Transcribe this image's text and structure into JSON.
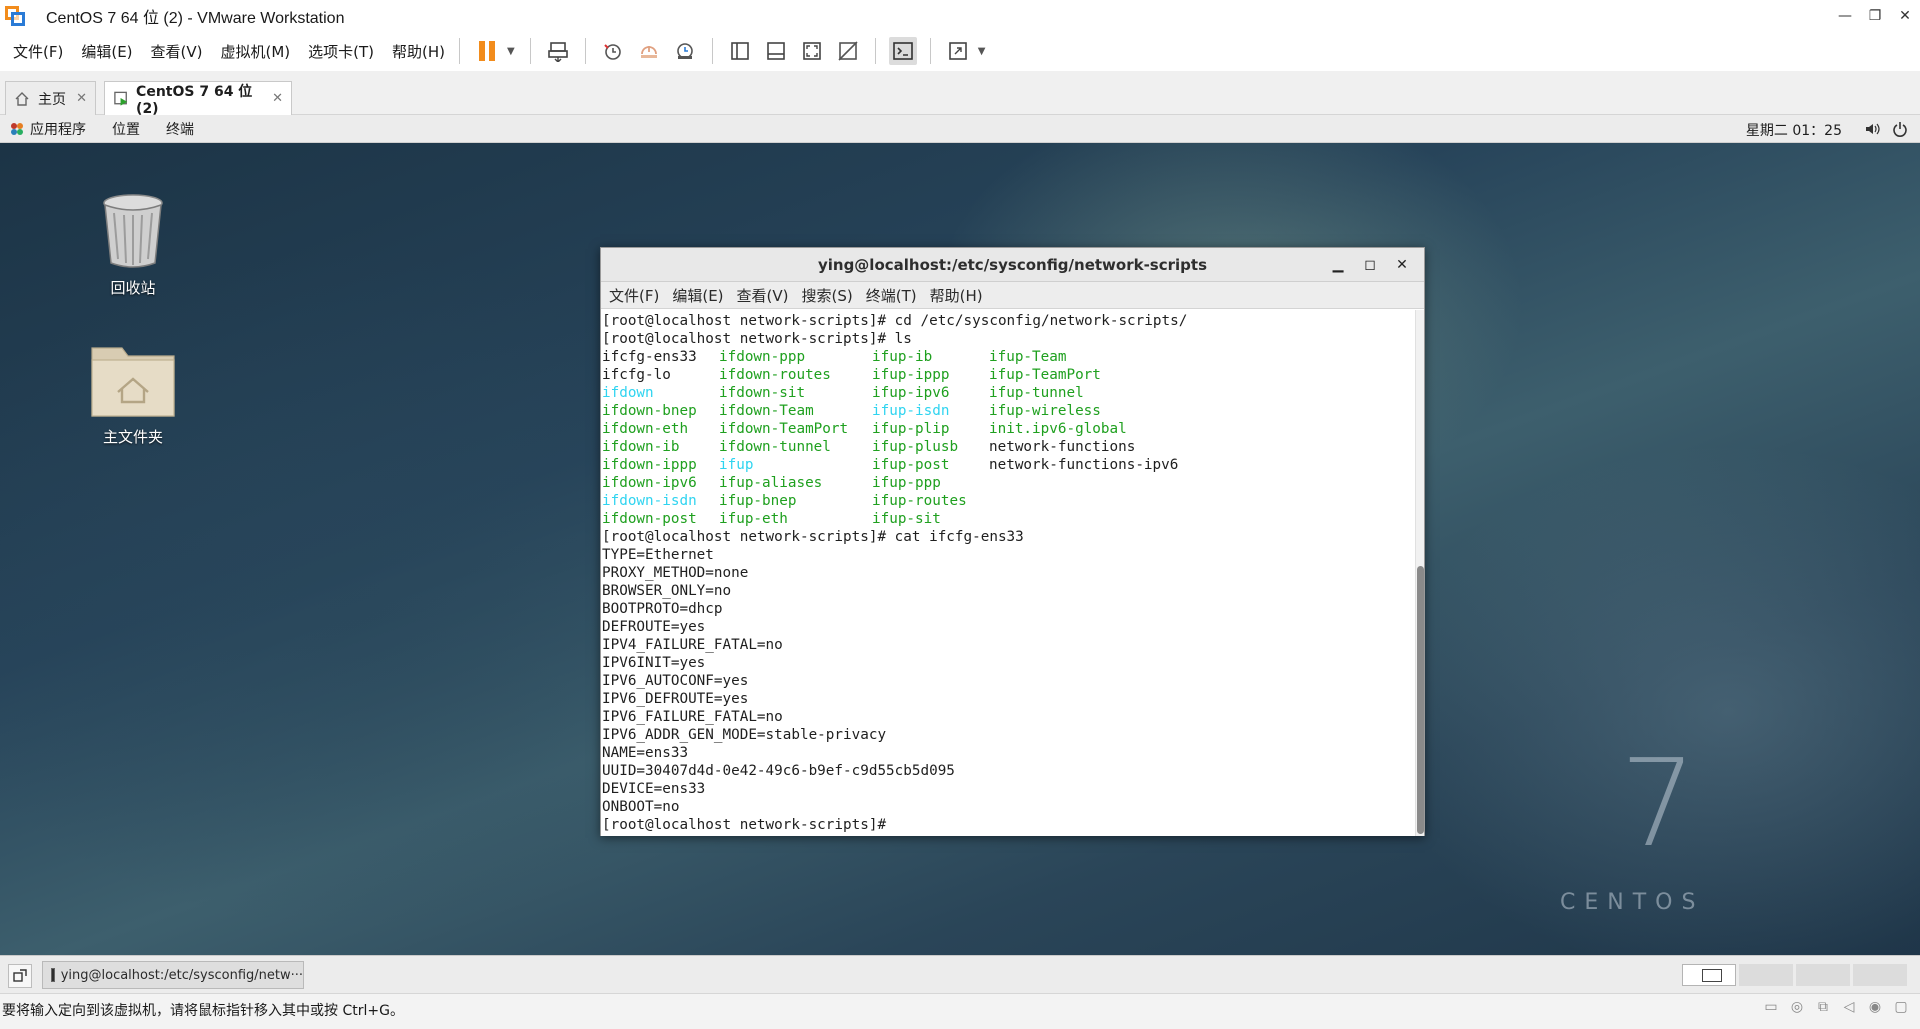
{
  "window": {
    "title": "CentOS 7 64 位 (2) - VMware Workstation"
  },
  "vmware_menu": [
    "文件(F)",
    "编辑(E)",
    "查看(V)",
    "虚拟机(M)",
    "选项卡(T)",
    "帮助(H)"
  ],
  "tabs": [
    {
      "label": "主页",
      "active": false
    },
    {
      "label": "CentOS 7 64 位 (2)",
      "active": true
    }
  ],
  "gnome_panel": {
    "menus": [
      "应用程序",
      "位置",
      "终端"
    ],
    "clock": "星期二 01：25"
  },
  "desktop_icons": [
    {
      "label": "回收站",
      "icon": "trash-icon"
    },
    {
      "label": "主文件夹",
      "icon": "home-folder-icon"
    }
  ],
  "watermark": {
    "digit": "7",
    "word": "CENTOS"
  },
  "terminal": {
    "title": "ying@localhost:/etc/sysconfig/network-scripts",
    "menu": [
      "文件(F)",
      "编辑(E)",
      "查看(V)",
      "搜索(S)",
      "终端(T)",
      "帮助(H)"
    ],
    "lines_before": [
      "[root@localhost network-scripts]# cd /etc/sysconfig/network-scripts/",
      "[root@localhost network-scripts]# ls"
    ],
    "ls_rows": [
      [
        {
          "t": "ifcfg-ens33",
          "c": ""
        },
        {
          "t": "ifdown-ppp",
          "c": "g"
        },
        {
          "t": "ifup-ib",
          "c": "g"
        },
        {
          "t": "ifup-Team",
          "c": "g"
        }
      ],
      [
        {
          "t": "ifcfg-lo",
          "c": ""
        },
        {
          "t": "ifdown-routes",
          "c": "g"
        },
        {
          "t": "ifup-ippp",
          "c": "g"
        },
        {
          "t": "ifup-TeamPort",
          "c": "g"
        }
      ],
      [
        {
          "t": "ifdown",
          "c": "cy"
        },
        {
          "t": "ifdown-sit",
          "c": "g"
        },
        {
          "t": "ifup-ipv6",
          "c": "g"
        },
        {
          "t": "ifup-tunnel",
          "c": "g"
        }
      ],
      [
        {
          "t": "ifdown-bnep",
          "c": "g"
        },
        {
          "t": "ifdown-Team",
          "c": "g"
        },
        {
          "t": "ifup-isdn",
          "c": "cy"
        },
        {
          "t": "ifup-wireless",
          "c": "g"
        }
      ],
      [
        {
          "t": "ifdown-eth",
          "c": "g"
        },
        {
          "t": "ifdown-TeamPort",
          "c": "g"
        },
        {
          "t": "ifup-plip",
          "c": "g"
        },
        {
          "t": "init.ipv6-global",
          "c": "g"
        }
      ],
      [
        {
          "t": "ifdown-ib",
          "c": "g"
        },
        {
          "t": "ifdown-tunnel",
          "c": "g"
        },
        {
          "t": "ifup-plusb",
          "c": "g"
        },
        {
          "t": "network-functions",
          "c": ""
        }
      ],
      [
        {
          "t": "ifdown-ippp",
          "c": "g"
        },
        {
          "t": "ifup",
          "c": "cy"
        },
        {
          "t": "ifup-post",
          "c": "g"
        },
        {
          "t": "network-functions-ipv6",
          "c": ""
        }
      ],
      [
        {
          "t": "ifdown-ipv6",
          "c": "g"
        },
        {
          "t": "ifup-aliases",
          "c": "g"
        },
        {
          "t": "ifup-ppp",
          "c": "g"
        },
        {
          "t": "",
          "c": ""
        }
      ],
      [
        {
          "t": "ifdown-isdn",
          "c": "cy"
        },
        {
          "t": "ifup-bnep",
          "c": "g"
        },
        {
          "t": "ifup-routes",
          "c": "g"
        },
        {
          "t": "",
          "c": ""
        }
      ],
      [
        {
          "t": "ifdown-post",
          "c": "g"
        },
        {
          "t": "ifup-eth",
          "c": "g"
        },
        {
          "t": "ifup-sit",
          "c": "g"
        },
        {
          "t": "",
          "c": ""
        }
      ]
    ],
    "lines_after": [
      "[root@localhost network-scripts]# cat ifcfg-ens33",
      "TYPE=Ethernet",
      "PROXY_METHOD=none",
      "BROWSER_ONLY=no",
      "BOOTPROTO=dhcp",
      "DEFROUTE=yes",
      "IPV4_FAILURE_FATAL=no",
      "IPV6INIT=yes",
      "IPV6_AUTOCONF=yes",
      "IPV6_DEFROUTE=yes",
      "IPV6_FAILURE_FATAL=no",
      "IPV6_ADDR_GEN_MODE=stable-privacy",
      "NAME=ens33",
      "UUID=30407d4d-0e42-49c6-b9ef-c9d55cb5d095",
      "DEVICE=ens33",
      "ONBOOT=no",
      "[root@localhost network-scripts]# "
    ]
  },
  "taskbar": {
    "item": "ying@localhost:/etc/sysconfig/netw···"
  },
  "statusbar": {
    "text": "要将输入定向到该虚拟机，请将鼠标指针移入其中或按 Ctrl+G。"
  },
  "colors": {
    "ls_exec": "#1fa01f",
    "ls_link": "#2fd4f0",
    "pause": "#f28c1c"
  }
}
